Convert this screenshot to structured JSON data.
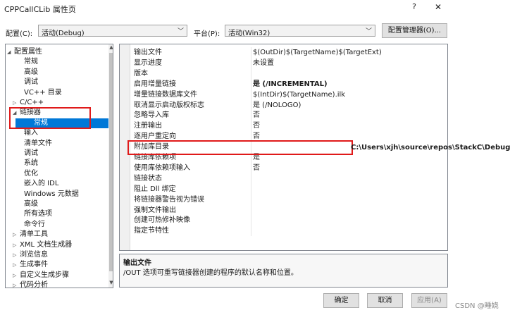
{
  "window": {
    "title": "CPPCallCLib 属性页",
    "help_label": "?",
    "close_label": "✕"
  },
  "config": {
    "config_label": "配置(C):",
    "config_value": "活动(Debug)",
    "platform_label": "平台(P):",
    "platform_value": "活动(Win32)",
    "manager_button": "配置管理器(O)..."
  },
  "tree": {
    "items": [
      {
        "label": "配置属性",
        "toggle": "◢",
        "selected": false
      },
      {
        "label": "常规",
        "toggle": "",
        "selected": false
      },
      {
        "label": "高级",
        "toggle": "",
        "selected": false
      },
      {
        "label": "调试",
        "toggle": "",
        "selected": false
      },
      {
        "label": "VC++ 目录",
        "toggle": "",
        "selected": false
      },
      {
        "label": "C/C++",
        "toggle": "▷",
        "selected": false
      },
      {
        "label": "链接器",
        "toggle": "◢",
        "selected": false
      },
      {
        "label": "常规",
        "toggle": "",
        "selected": true
      },
      {
        "label": "输入",
        "toggle": "",
        "selected": false
      },
      {
        "label": "清单文件",
        "toggle": "",
        "selected": false
      },
      {
        "label": "调试",
        "toggle": "",
        "selected": false
      },
      {
        "label": "系统",
        "toggle": "",
        "selected": false
      },
      {
        "label": "优化",
        "toggle": "",
        "selected": false
      },
      {
        "label": "嵌入的 IDL",
        "toggle": "",
        "selected": false
      },
      {
        "label": "Windows 元数据",
        "toggle": "",
        "selected": false
      },
      {
        "label": "高级",
        "toggle": "",
        "selected": false
      },
      {
        "label": "所有选项",
        "toggle": "",
        "selected": false
      },
      {
        "label": "命令行",
        "toggle": "",
        "selected": false
      },
      {
        "label": "清单工具",
        "toggle": "▷",
        "selected": false
      },
      {
        "label": "XML 文档生成器",
        "toggle": "▷",
        "selected": false
      },
      {
        "label": "浏览信息",
        "toggle": "▷",
        "selected": false
      },
      {
        "label": "生成事件",
        "toggle": "▷",
        "selected": false
      },
      {
        "label": "自定义生成步骤",
        "toggle": "▷",
        "selected": false
      },
      {
        "label": "代码分析",
        "toggle": "▷",
        "selected": false
      }
    ]
  },
  "grid": {
    "rows": [
      {
        "name": "输出文件",
        "value": "$(OutDir)$(TargetName)$(TargetExt)",
        "bold": false
      },
      {
        "name": "显示进度",
        "value": "未设置",
        "bold": false
      },
      {
        "name": "版本",
        "value": "",
        "bold": false
      },
      {
        "name": "启用增量链接",
        "value": "是 (/INCREMENTAL)",
        "bold": true
      },
      {
        "name": "增量链接数据库文件",
        "value": "$(IntDir)$(TargetName).ilk",
        "bold": false
      },
      {
        "name": "取消显示启动版权标志",
        "value": "是 (/NOLOGO)",
        "bold": false
      },
      {
        "name": "忽略导入库",
        "value": "否",
        "bold": false
      },
      {
        "name": "注册输出",
        "value": "否",
        "bold": false
      },
      {
        "name": "逐用户重定向",
        "value": "否",
        "bold": false
      },
      {
        "name": "附加库目录",
        "value": "",
        "bold": false
      },
      {
        "name": "链接库依赖项",
        "value": "是",
        "bold": false
      },
      {
        "name": "使用库依赖项输入",
        "value": "否",
        "bold": false
      },
      {
        "name": "链接状态",
        "value": "",
        "bold": false
      },
      {
        "name": "阻止 Dll 绑定",
        "value": "",
        "bold": false
      },
      {
        "name": "将链接器警告视为错误",
        "value": "",
        "bold": false
      },
      {
        "name": "强制文件输出",
        "value": "",
        "bold": false
      },
      {
        "name": "创建可热修补映像",
        "value": "",
        "bold": false
      },
      {
        "name": "指定节特性",
        "value": "",
        "bold": false
      }
    ],
    "edit_value": "C:\\Users\\xjh\\source\\repos\\StackC\\Debug"
  },
  "description": {
    "title": "输出文件",
    "text": "/OUT 选项可重写链接器创建的程序的默认名称和位置。"
  },
  "buttons": {
    "ok": "确定",
    "cancel": "取消",
    "apply": "应用(A)"
  },
  "watermark": "CSDN @睡娆",
  "colors": {
    "selection": "#0078d7",
    "annotation": "#e01a1a"
  }
}
